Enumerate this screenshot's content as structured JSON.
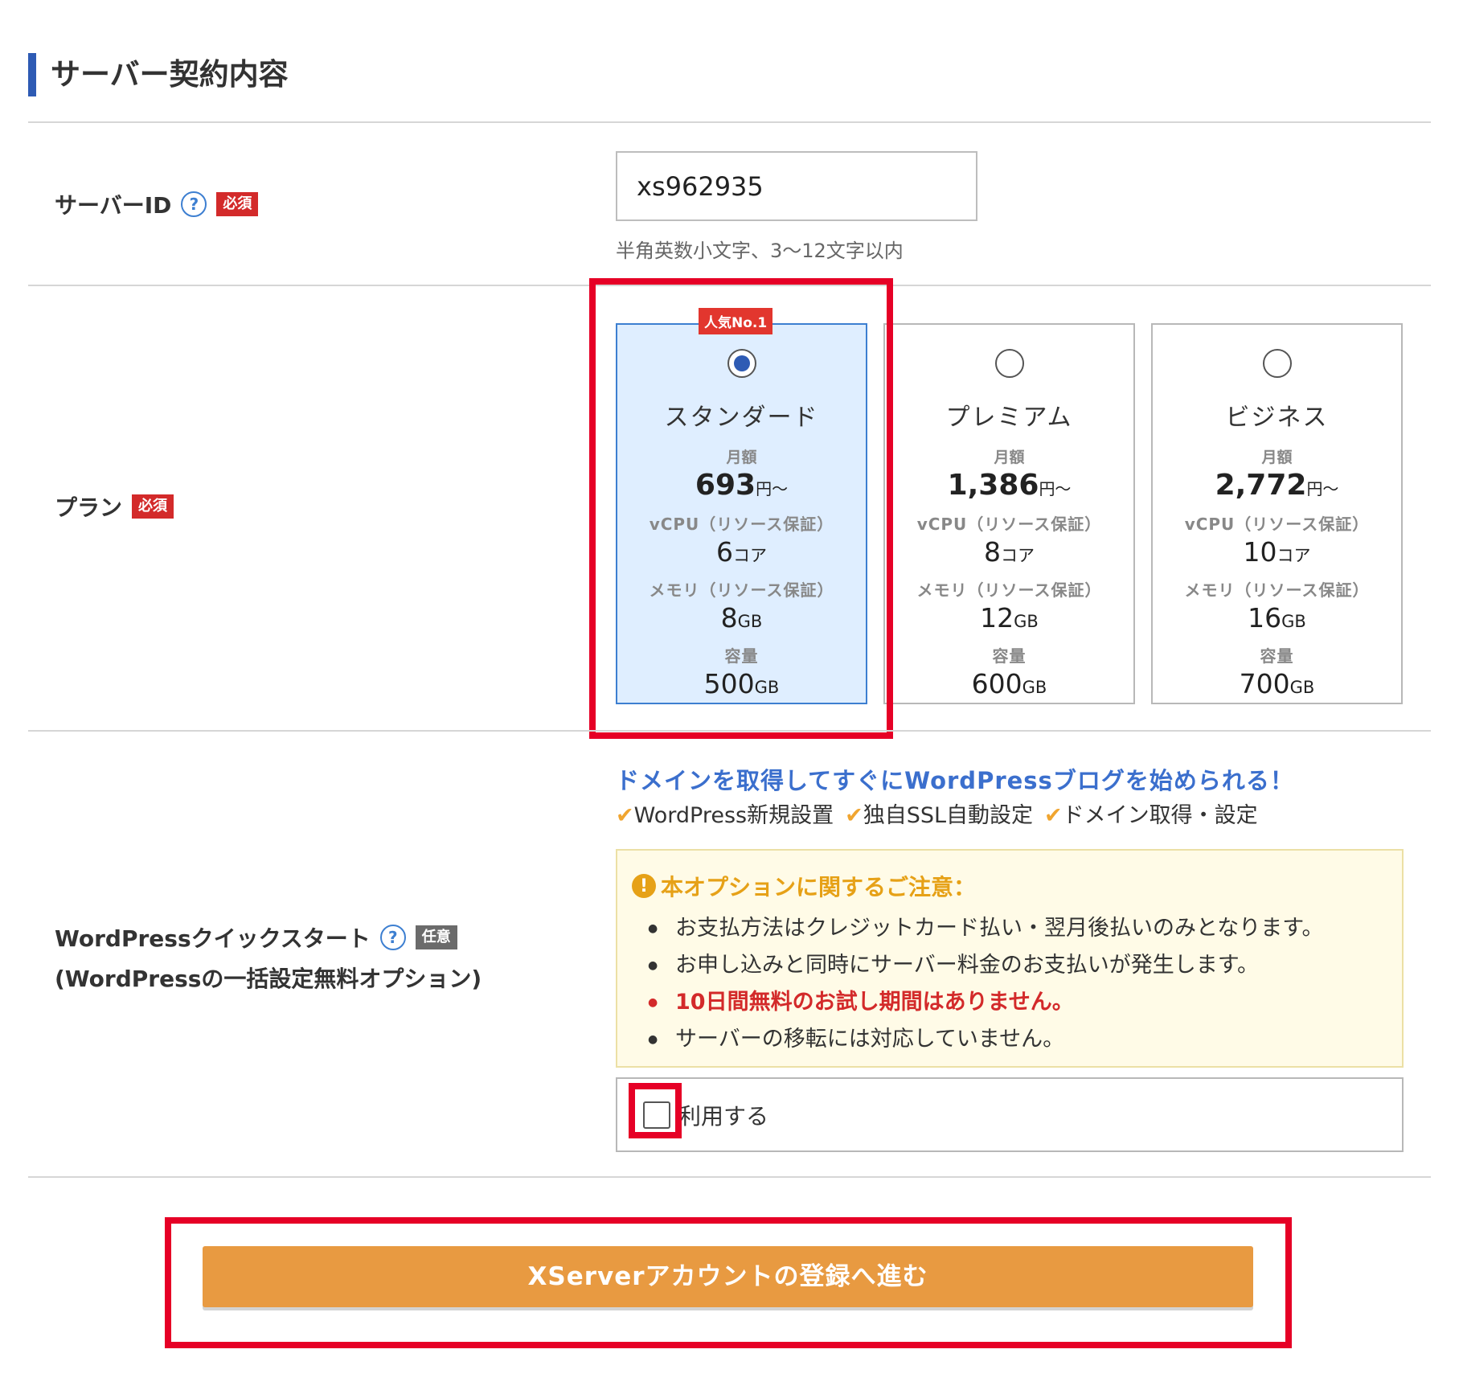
{
  "section": {
    "title": "サーバー契約内容"
  },
  "server_id": {
    "label": "サーバーID",
    "help": "?",
    "required_badge": "必須",
    "value": "xs962935",
    "hint": "半角英数小文字、3〜12文字以内"
  },
  "plan": {
    "label": "プラン",
    "required_badge": "必須",
    "popular_badge": "人気No.1",
    "selected": "スタンダード",
    "cards": [
      {
        "name": "スタンダード",
        "monthly_label": "月額",
        "price": "693",
        "price_unit": "円〜",
        "vcpu_label": "vCPU（リソース保証）",
        "vcpu": "6",
        "vcpu_unit": "コア",
        "memory_label": "メモリ（リソース保証）",
        "memory": "8",
        "memory_unit": "GB",
        "storage_label": "容量",
        "storage": "500",
        "storage_unit": "GB"
      },
      {
        "name": "プレミアム",
        "monthly_label": "月額",
        "price": "1,386",
        "price_unit": "円〜",
        "vcpu_label": "vCPU（リソース保証）",
        "vcpu": "8",
        "vcpu_unit": "コア",
        "memory_label": "メモリ（リソース保証）",
        "memory": "12",
        "memory_unit": "GB",
        "storage_label": "容量",
        "storage": "600",
        "storage_unit": "GB"
      },
      {
        "name": "ビジネス",
        "monthly_label": "月額",
        "price": "2,772",
        "price_unit": "円〜",
        "vcpu_label": "vCPU（リソース保証）",
        "vcpu": "10",
        "vcpu_unit": "コア",
        "memory_label": "メモリ（リソース保証）",
        "memory": "16",
        "memory_unit": "GB",
        "storage_label": "容量",
        "storage": "700",
        "storage_unit": "GB"
      }
    ]
  },
  "wordpress": {
    "label_line1": "WordPressクイックスタート",
    "label_line2": "(WordPressの一括設定無料オプション)",
    "help": "?",
    "optional_badge": "任意",
    "tagline": "ドメインを取得してすぐにWordPressブログを始められる！",
    "features": [
      "WordPress新規設置",
      "独自SSL自動設定",
      "ドメイン取得・設定"
    ],
    "check_mark": "✔",
    "notice_icon": "!",
    "notice_title": "本オプションに関するご注意：",
    "notice_items": [
      "お支払方法はクレジットカード払い・翌月後払いのみとなります。",
      "お申し込みと同時にサーバー料金のお支払いが発生します。",
      "10日間無料のお試し期間はありません。",
      "サーバーの移転には対応していません。"
    ],
    "use_label": "利用する",
    "use_checked": false
  },
  "submit": {
    "label": "XServerアカウントの登録へ進む"
  },
  "colors": {
    "accent": "#2e5bb4",
    "required": "#d32a2a",
    "button": "#e89a41",
    "highlight": "#e60026",
    "notice_bg": "#fffbe7"
  }
}
